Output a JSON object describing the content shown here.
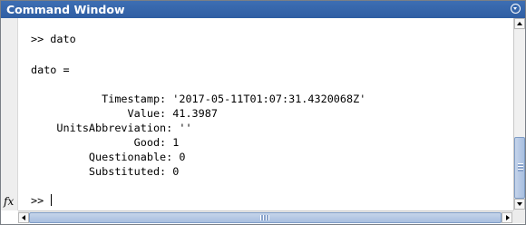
{
  "window": {
    "title": "Command Window"
  },
  "console": {
    "lines": [
      ">> dato",
      "dato =",
      "           Timestamp: '2017-05-11T01:07:31.4320068Z'",
      "               Value: 41.3987",
      "    UnitsAbbreviation: ''",
      "                Good: 1",
      "         Questionable: 0",
      "         Substituted: 0"
    ],
    "prompt": ">> ",
    "fx_label": "fx"
  },
  "icons": {
    "title_menu": "chevron-down-circle-icon",
    "scroll_up": "arrow-up-icon",
    "scroll_down": "arrow-down-icon",
    "scroll_left": "arrow-left-icon",
    "scroll_right": "arrow-right-icon",
    "function_browser": "fx-icon"
  }
}
